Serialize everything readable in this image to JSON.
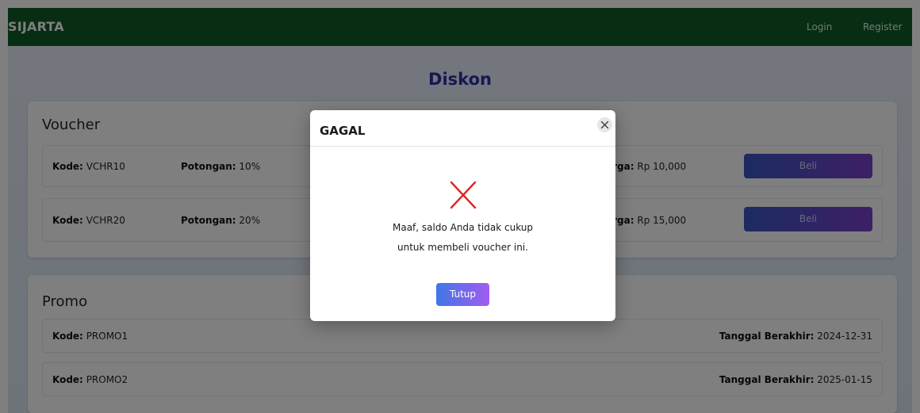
{
  "navbar": {
    "brand": "SIJARTA",
    "login": "Login",
    "register": "Register",
    "bg_color": "#0f5a24"
  },
  "page": {
    "title": "Diskon"
  },
  "voucher": {
    "title": "Voucher",
    "items": [
      {
        "kode_label": "Kode:",
        "kode": "VCHR10",
        "potongan_label": "Potongan:",
        "potongan": "10%",
        "harga_label": "Harga:",
        "harga": "Rp 10,000",
        "button": "Beli"
      },
      {
        "kode_label": "Kode:",
        "kode": "VCHR20",
        "potongan_label": "Potongan:",
        "potongan": "20%",
        "harga_label": "Harga:",
        "harga": "Rp 15,000",
        "button": "Beli"
      }
    ]
  },
  "promo": {
    "title": "Promo",
    "items": [
      {
        "kode_label": "Kode:",
        "kode": "PROMO1",
        "tanggal_label": "Tanggal Berakhir:",
        "tanggal": "2024-12-31"
      },
      {
        "kode_label": "Kode:",
        "kode": "PROMO2",
        "tanggal_label": "Tanggal Berakhir:",
        "tanggal": "2025-01-15"
      }
    ]
  },
  "modal": {
    "title": "GAGAL",
    "close_icon": "close-icon",
    "status_icon": "error-x-icon",
    "status_color": "#e02424",
    "message_line1": "Maaf, saldo Anda tidak cukup",
    "message_line2": "untuk membeli voucher ini.",
    "button": "Tutup"
  }
}
